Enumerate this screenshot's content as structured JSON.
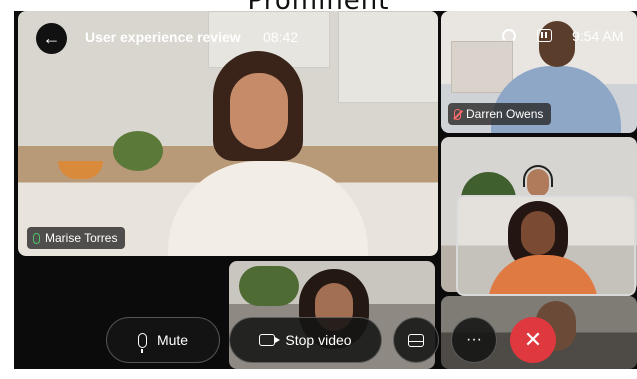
{
  "caption": "Prominent",
  "header": {
    "title": "User experience review",
    "timer": "08:42",
    "clock": "9:54 AM",
    "back_icon": "arrow-left-icon",
    "headset_icon": "headset-icon",
    "layout_icon": "layout-icon"
  },
  "participants": [
    {
      "name": "Marise Torres",
      "mic": "on"
    },
    {
      "name": "Darren Owens",
      "mic": "muted"
    }
  ],
  "controls": {
    "mute_label": "Mute",
    "stop_video_label": "Stop video",
    "more_label": "···",
    "end_label": "✕"
  },
  "colors": {
    "end_call": "#e0383f",
    "mic_active": "#4cc26a",
    "mic_muted": "#ff6b6b"
  }
}
